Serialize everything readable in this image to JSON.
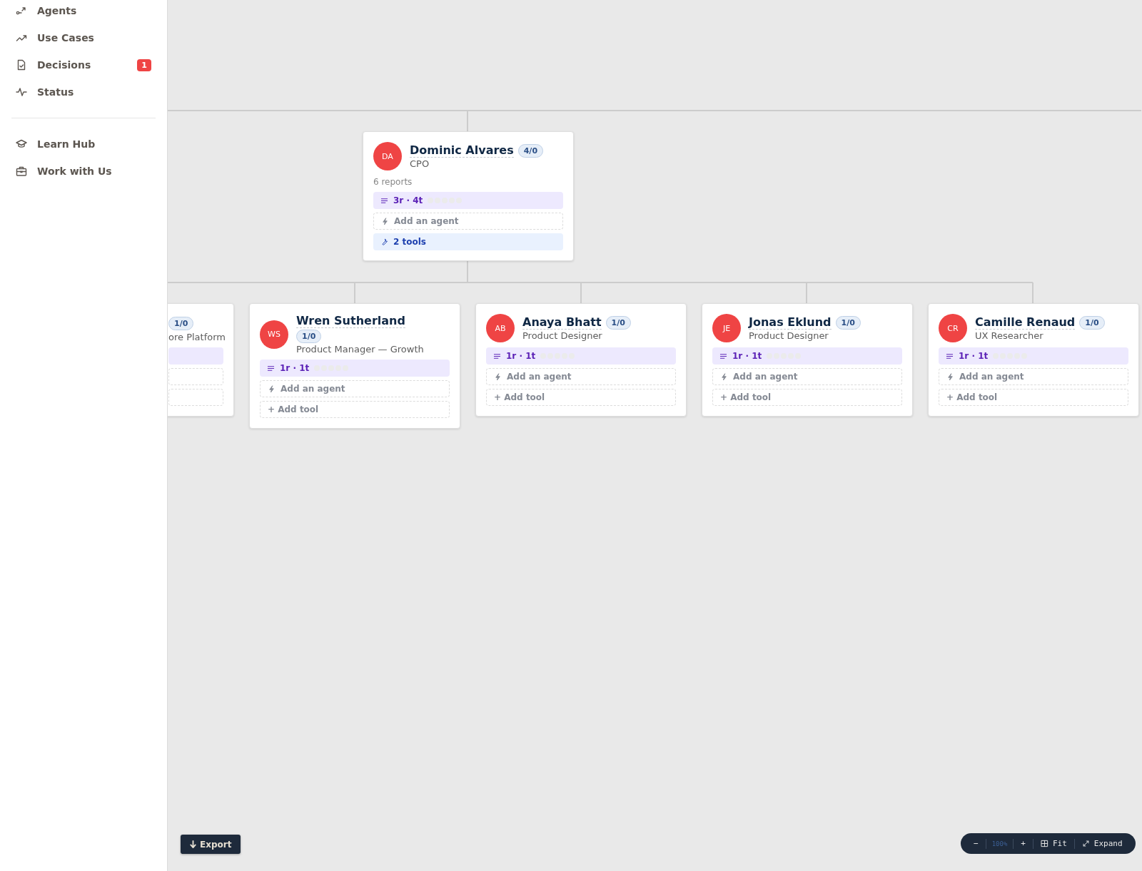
{
  "sidebar": {
    "items": [
      {
        "label": "Agents"
      },
      {
        "label": "Use Cases"
      },
      {
        "label": "Decisions",
        "badge": "1"
      },
      {
        "label": "Status"
      }
    ],
    "secondary_items": [
      {
        "label": "Learn Hub"
      },
      {
        "label": "Work with Us"
      }
    ]
  },
  "org_chart": {
    "root": {
      "initials": "DA",
      "name": "Dominic Alvares",
      "count": "4/0",
      "role": "CPO",
      "reports": "6 reports",
      "stats": "3r · 4t",
      "add_agent": "Add an agent",
      "tools": {
        "kind": "count",
        "label": "2 tools"
      }
    },
    "children": [
      {
        "kind": "clipped",
        "count": "1/0",
        "role": "ore Platform"
      },
      {
        "kind": "full",
        "initials": "WS",
        "name": "Wren Sutherland",
        "count": "1/0",
        "role": "Product Manager — Growth",
        "stats": "1r · 1t",
        "add_agent": "Add an agent",
        "tools": {
          "kind": "add",
          "label": "+ Add tool"
        }
      },
      {
        "kind": "full",
        "initials": "AB",
        "name": "Anaya Bhatt",
        "count": "1/0",
        "role": "Product Designer",
        "stats": "1r · 1t",
        "add_agent": "Add an agent",
        "tools": {
          "kind": "add",
          "label": "+ Add tool"
        }
      },
      {
        "kind": "full",
        "initials": "JE",
        "name": "Jonas Eklund",
        "count": "1/0",
        "role": "Product Designer",
        "stats": "1r · 1t",
        "add_agent": "Add an agent",
        "tools": {
          "kind": "add",
          "label": "+ Add tool"
        }
      },
      {
        "kind": "full",
        "initials": "CR",
        "name": "Camille Renaud",
        "count": "1/0",
        "role": "UX Researcher",
        "stats": "1r · 1t",
        "add_agent": "Add an agent",
        "tools": {
          "kind": "add",
          "label": "+ Add tool"
        }
      }
    ]
  },
  "export_button": "Export",
  "zoom_controls": {
    "zoom_out": "−",
    "zoom_level": "100%",
    "zoom_in": "+",
    "fit": "Fit",
    "expand": "Expand"
  }
}
